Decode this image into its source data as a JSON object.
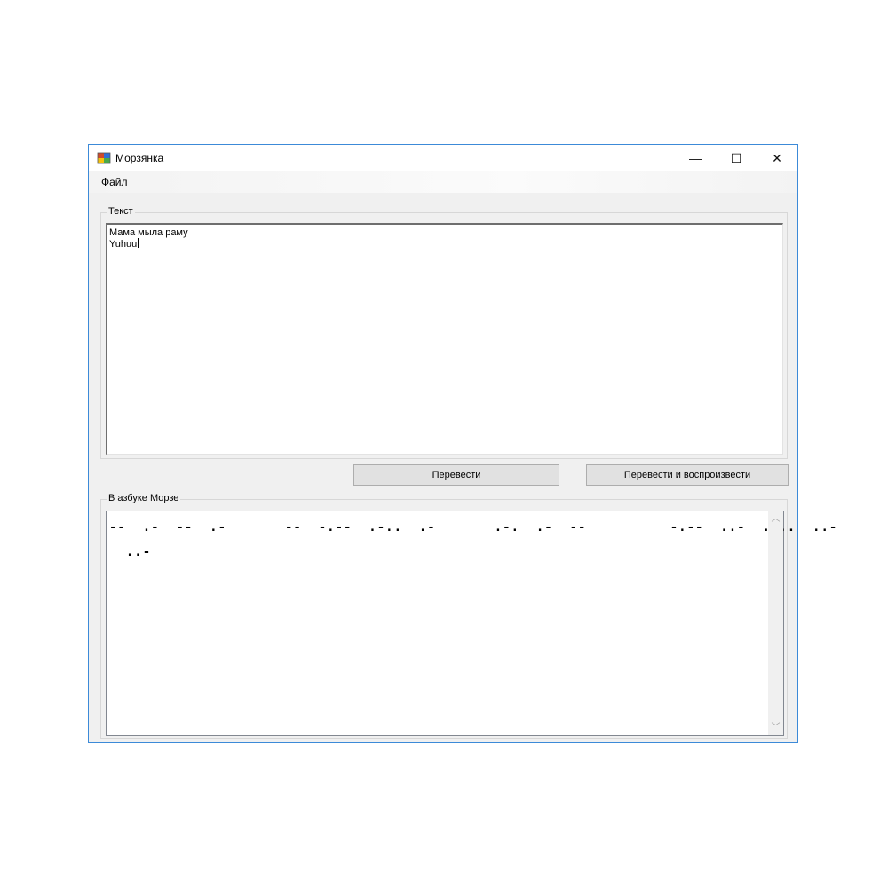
{
  "window": {
    "title": "Морзянка",
    "minimize": "—",
    "maximize": "☐",
    "close": "✕"
  },
  "menu": {
    "file": "Файл"
  },
  "input_group": {
    "label": "Текст",
    "lines": [
      "Мама мыла раму",
      "Yuhuu"
    ]
  },
  "buttons": {
    "translate": "Перевести",
    "translate_play": "Перевести и воспроизвести"
  },
  "output_group": {
    "label": "В азбуке Морзе",
    "lines": [
      "--  .-  --  .-       --  -.--  .-..  .-       .-.  .-  --          -.--  ..-  ....  ..-",
      "  ..-"
    ]
  },
  "icons": {
    "app": "app-icon",
    "scroll_up": "chevron-up-icon",
    "scroll_down": "chevron-down-icon"
  },
  "colors": {
    "window_border": "#3c8ad8",
    "face": "#f0f0f0",
    "button": "#e1e1e1"
  }
}
